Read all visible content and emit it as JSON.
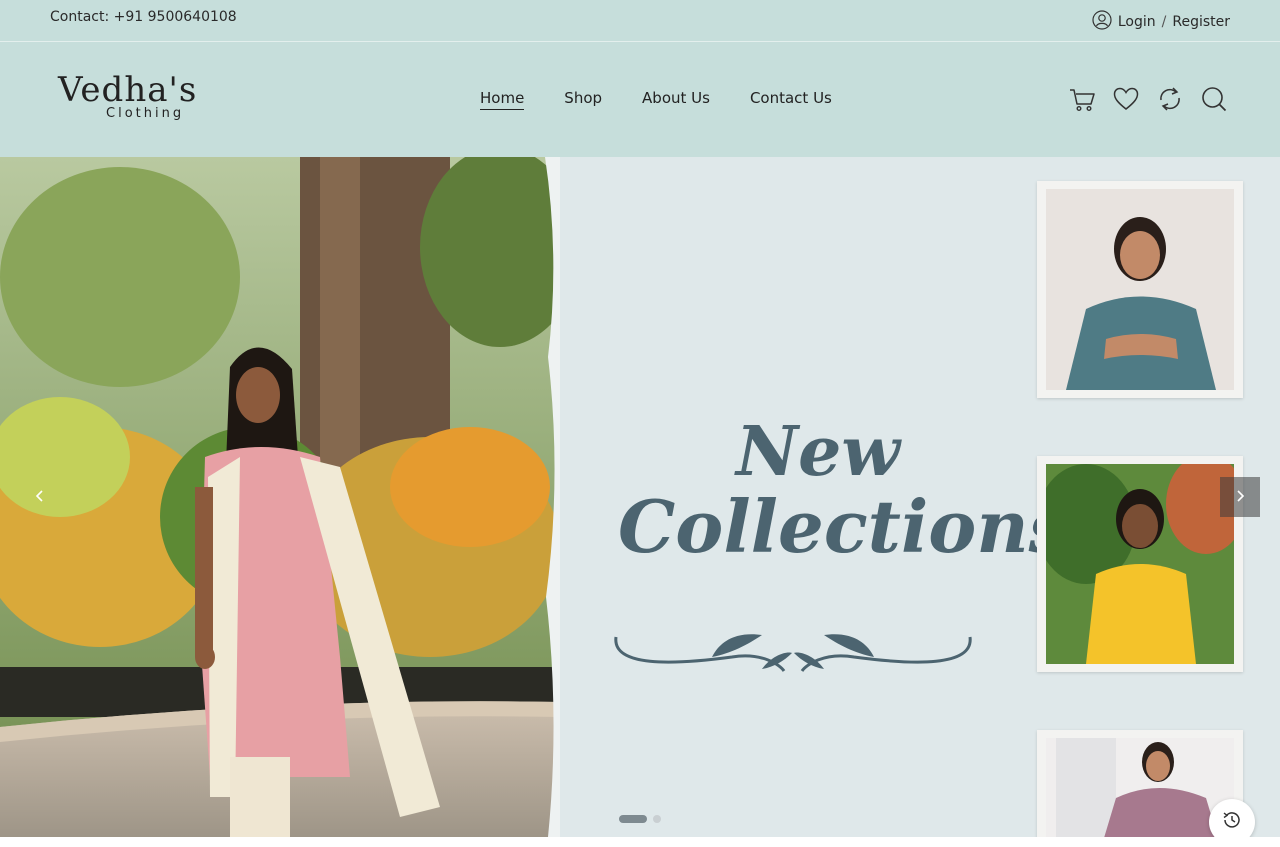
{
  "topbar": {
    "contact": "Contact: +91 9500640108",
    "login": "Login",
    "separator": "/",
    "register": "Register"
  },
  "header": {
    "brand": "Vedha's",
    "brand_sub": "Clothing",
    "nav": [
      {
        "label": "Home",
        "active": true
      },
      {
        "label": "Shop",
        "active": false
      },
      {
        "label": "About Us",
        "active": false
      },
      {
        "label": "Contact Us",
        "active": false
      }
    ],
    "icons": [
      "cart-icon",
      "heart-icon",
      "compare-icon",
      "search-icon"
    ]
  },
  "hero": {
    "title_line1": "New",
    "title_line2": "Collections",
    "slides_total": 2,
    "active_slide": 1
  },
  "colors": {
    "header_bg": "#c6dedb",
    "title": "#4c6470"
  }
}
